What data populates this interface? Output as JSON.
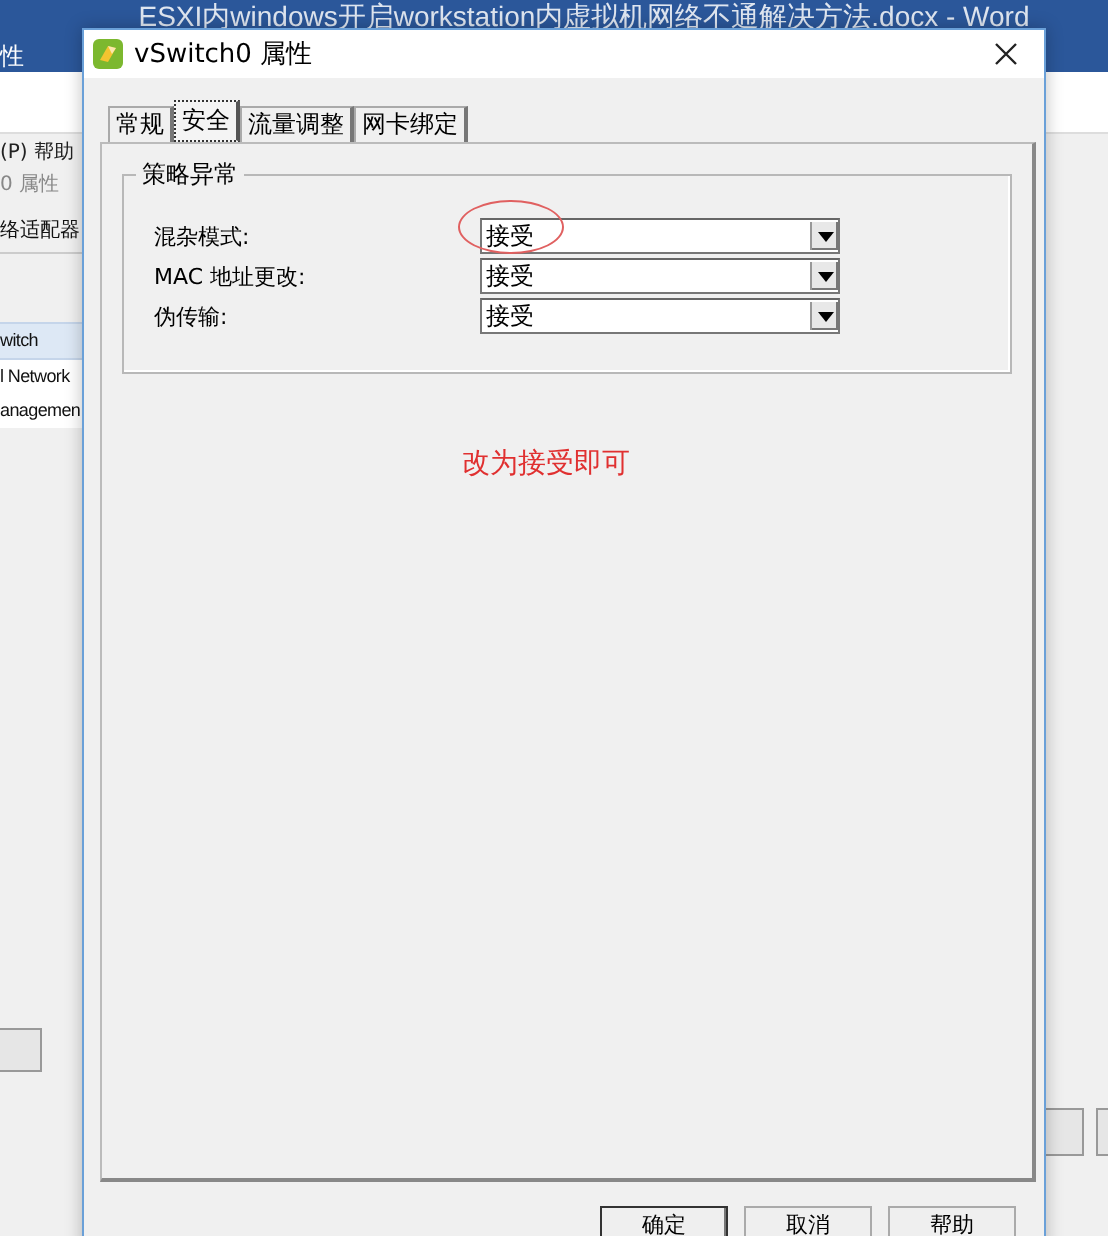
{
  "background_window": {
    "title": "ESXI内windows开启workstation内虚拟机网络不通解决方法.docx  -  Word",
    "ribbon_tabs": [
      "性"
    ],
    "menu_items": [
      "(P)",
      "帮助"
    ],
    "dialog_title": "0 属性",
    "section_label": "络适配器",
    "list_items": [
      {
        "label": "witch",
        "selected": true
      },
      {
        "label": "l Network",
        "selected": false
      },
      {
        "label": "anagemen",
        "selected": false
      }
    ]
  },
  "dialog": {
    "title": "vSwitch0 属性",
    "tabs": [
      {
        "label": "常规",
        "selected": false
      },
      {
        "label": "安全",
        "selected": true
      },
      {
        "label": "流量调整",
        "selected": false
      },
      {
        "label": "网卡绑定",
        "selected": false
      }
    ],
    "group": {
      "title": "策略异常",
      "rows": [
        {
          "label": "混杂模式:",
          "value": "接受",
          "highlighted": true
        },
        {
          "label": "MAC 地址更改:",
          "value": "接受",
          "highlighted": false
        },
        {
          "label": "伪传输:",
          "value": "接受",
          "highlighted": false
        }
      ]
    },
    "annotation": "改为接受即可",
    "buttons": [
      {
        "label": "确定",
        "default": true
      },
      {
        "label": "取消",
        "default": false
      },
      {
        "label": "帮助",
        "default": false
      }
    ]
  }
}
